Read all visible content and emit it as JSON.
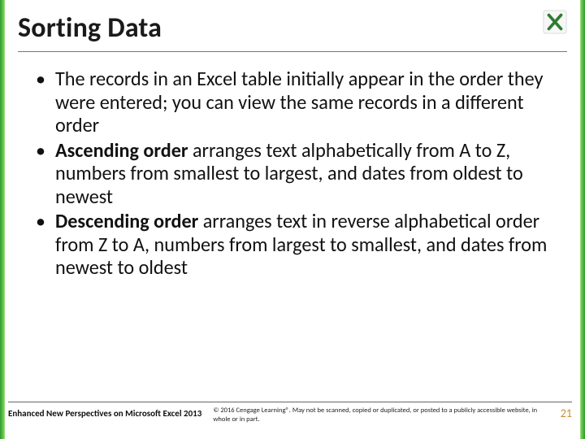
{
  "title": "Sorting Data",
  "bullets": [
    {
      "pre": "",
      "bold": "",
      "post": "The records in an Excel table initially appear in the order they were entered; you can view the same records in a different order"
    },
    {
      "pre": "",
      "bold": "Ascending order",
      "post": " arranges text alphabetically from A to Z, numbers from smallest to largest, and dates from oldest to newest"
    },
    {
      "pre": "",
      "bold": "Descending order",
      "post": " arranges text in reverse alphabetical order from Z to A, numbers from largest to smallest, and dates from newest to oldest"
    }
  ],
  "footer": {
    "left": "Enhanced New Perspectives on Microsoft Excel 2013",
    "mid": "© 2016 Cengage Learning®. May not be scanned, copied or duplicated, or posted to a publicly accessible website, in whole or in part.",
    "page": "21"
  },
  "icon_name": "excel-x-icon",
  "colors": {
    "edge_green": "#2e9b2e",
    "page_number": "#c98b2f"
  }
}
